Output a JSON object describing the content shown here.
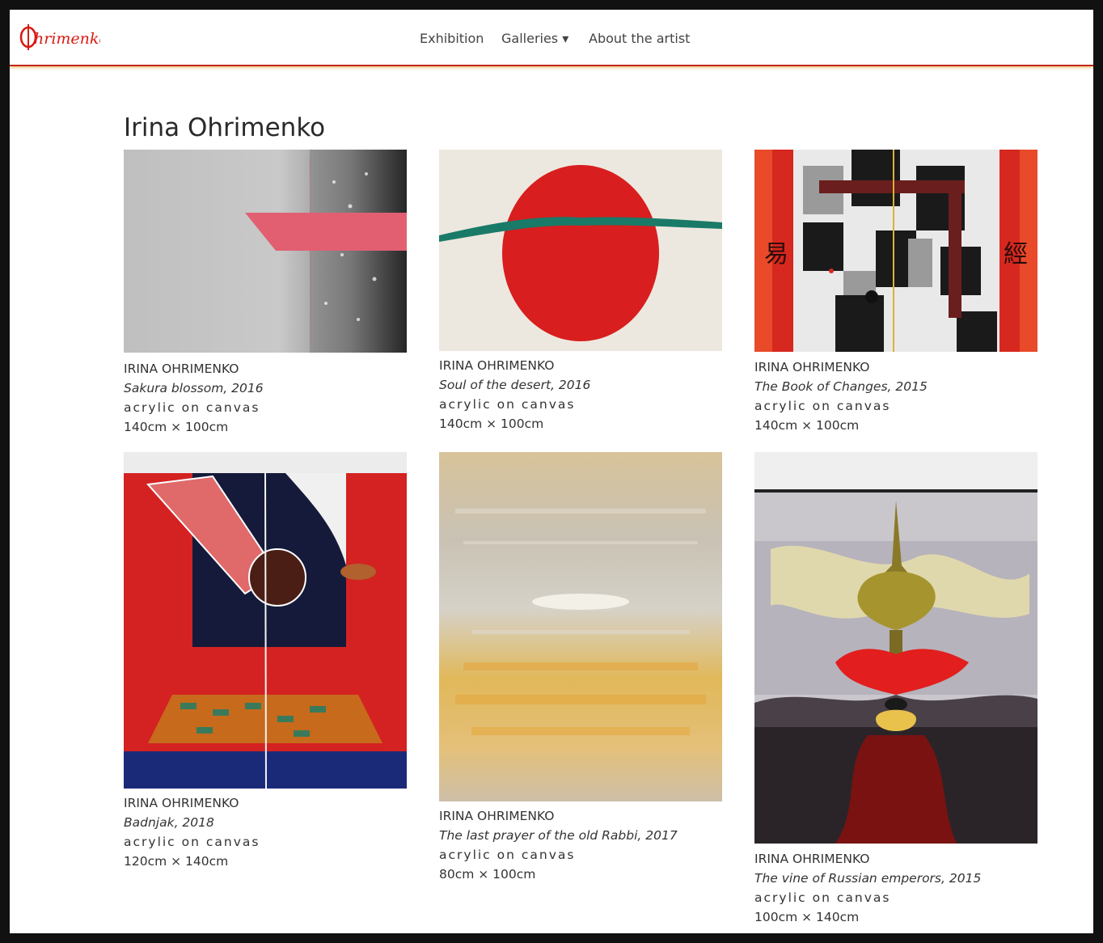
{
  "site": {
    "logo_text": "Ohrimenko",
    "brand_color": "#d91a12",
    "accent_color": "#e2a028"
  },
  "nav": {
    "items": [
      {
        "label": "Exhibition"
      },
      {
        "label": "Galleries ▾"
      },
      {
        "label": "About the artist"
      }
    ]
  },
  "page": {
    "title": "Irina Ohrimenko"
  },
  "artworks": [
    {
      "artist": "IRINA OHRIMENKO",
      "name": "Sakura blossom, 2016",
      "medium": "acrylic on canvas",
      "size": "140cm × 100cm"
    },
    {
      "artist": "IRINA OHRIMENKO",
      "name": "Soul of the desert, 2016",
      "medium": "acrylic on canvas",
      "size": "140cm × 100cm"
    },
    {
      "artist": "IRINA OHRIMENKO",
      "name": "The Book of Changes, 2015",
      "medium": "acrylic on canvas",
      "size": "140cm × 100cm"
    },
    {
      "artist": "IRINA OHRIMENKO",
      "name": "Badnjak, 2018",
      "medium": "acrylic on canvas",
      "size": "120cm × 140cm"
    },
    {
      "artist": "IRINA OHRIMENKO",
      "name": "The last prayer of the old Rabbi, 2017",
      "medium": "acrylic on canvas",
      "size": "80cm × 100cm"
    },
    {
      "artist": "IRINA OHRIMENKO",
      "name": "The vine of Russian emperors, 2015",
      "medium": "acrylic on canvas",
      "size": "100cm × 140cm"
    }
  ],
  "painting_glyphs": {
    "left": "易",
    "right": "經"
  }
}
